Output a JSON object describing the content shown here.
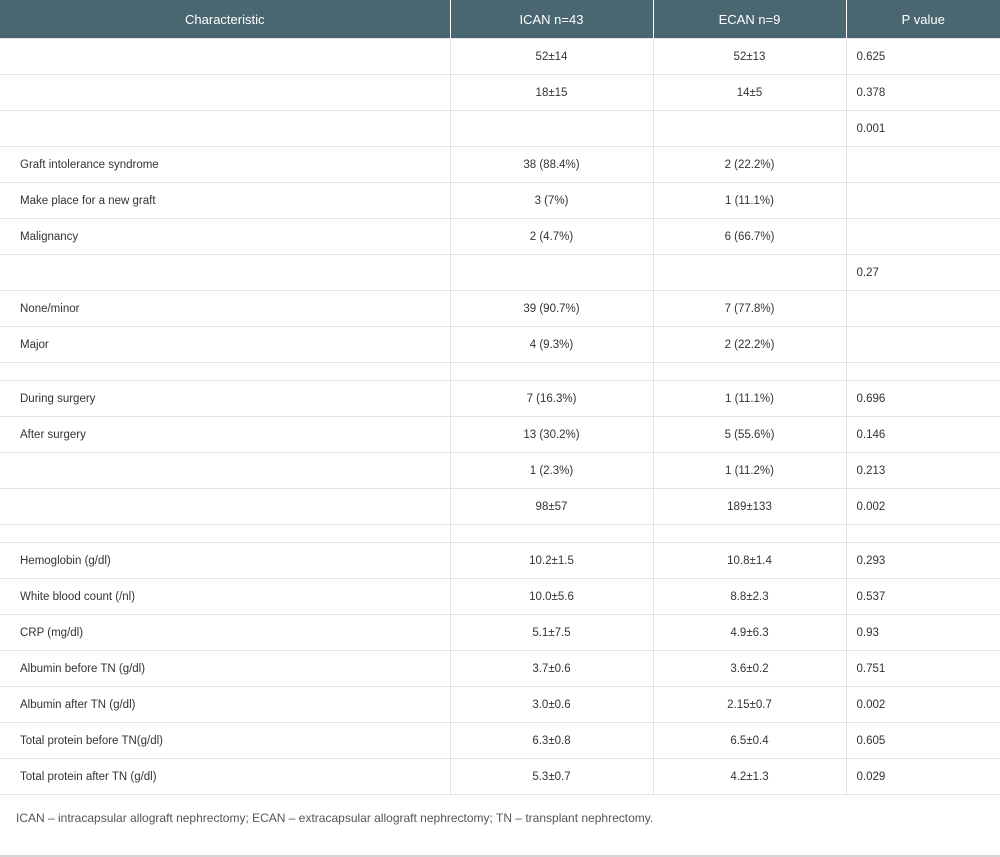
{
  "table": {
    "headers": [
      "Characteristic",
      "ICAN n=43",
      "ECAN n=9",
      "P value"
    ],
    "rows": [
      {
        "char": "",
        "ican": "52±14",
        "ecan": "52±13",
        "p": "0.625"
      },
      {
        "char": "",
        "ican": "18±15",
        "ecan": "14±5",
        "p": "0.378"
      },
      {
        "char": "",
        "ican": "",
        "ecan": "",
        "p": "0.001"
      },
      {
        "char": "Graft intolerance syndrome",
        "ican": "38 (88.4%)",
        "ecan": "2 (22.2%)",
        "p": ""
      },
      {
        "char": "Make place for a new graft",
        "ican": "3 (7%)",
        "ecan": "1 (11.1%)",
        "p": ""
      },
      {
        "char": "Malignancy",
        "ican": "2 (4.7%)",
        "ecan": "6 (66.7%)",
        "p": ""
      },
      {
        "char": "",
        "ican": "",
        "ecan": "",
        "p": "0.27"
      },
      {
        "char": "None/minor",
        "ican": "39 (90.7%)",
        "ecan": "7 (77.8%)",
        "p": ""
      },
      {
        "char": "Major",
        "ican": "4 (9.3%)",
        "ecan": "2 (22.2%)",
        "p": ""
      },
      {
        "char": "",
        "ican": "",
        "ecan": "",
        "p": ""
      },
      {
        "char": "During surgery",
        "ican": "7 (16.3%)",
        "ecan": "1 (11.1%)",
        "p": "0.696"
      },
      {
        "char": "After surgery",
        "ican": "13 (30.2%)",
        "ecan": "5 (55.6%)",
        "p": "0.146"
      },
      {
        "char": "",
        "ican": "1 (2.3%)",
        "ecan": "1 (11.2%)",
        "p": "0.213"
      },
      {
        "char": "",
        "ican": "98±57",
        "ecan": "189±133",
        "p": "0.002"
      },
      {
        "char": "",
        "ican": "",
        "ecan": "",
        "p": ""
      },
      {
        "char": "Hemoglobin (g/dl)",
        "ican": "10.2±1.5",
        "ecan": "10.8±1.4",
        "p": "0.293"
      },
      {
        "char": "White blood count (/nl)",
        "ican": "10.0±5.6",
        "ecan": "8.8±2.3",
        "p": "0.537"
      },
      {
        "char": "CRP (mg/dl)",
        "ican": "5.1±7.5",
        "ecan": "4.9±6.3",
        "p": "0.93"
      },
      {
        "char": "Albumin before TN (g/dl)",
        "ican": "3.7±0.6",
        "ecan": "3.6±0.2",
        "p": "0.751"
      },
      {
        "char": "Albumin after TN (g/dl)",
        "ican": "3.0±0.6",
        "ecan": "2.15±0.7",
        "p": "0.002"
      },
      {
        "char": "Total protein before TN(g/dl)",
        "ican": "6.3±0.8",
        "ecan": "6.5±0.4",
        "p": "0.605"
      },
      {
        "char": "Total protein after TN (g/dl)",
        "ican": "5.3±0.7",
        "ecan": "4.2±1.3",
        "p": "0.029"
      }
    ]
  },
  "footnote": "ICAN – intracapsular allograft nephrectomy; ECAN – extracapsular allograft nephrectomy; TN – transplant nephrectomy.",
  "colors": {
    "header_bg": "#4a6670",
    "header_text": "#ffffff",
    "body_text": "#333333",
    "rule": "#e3e3e3"
  }
}
